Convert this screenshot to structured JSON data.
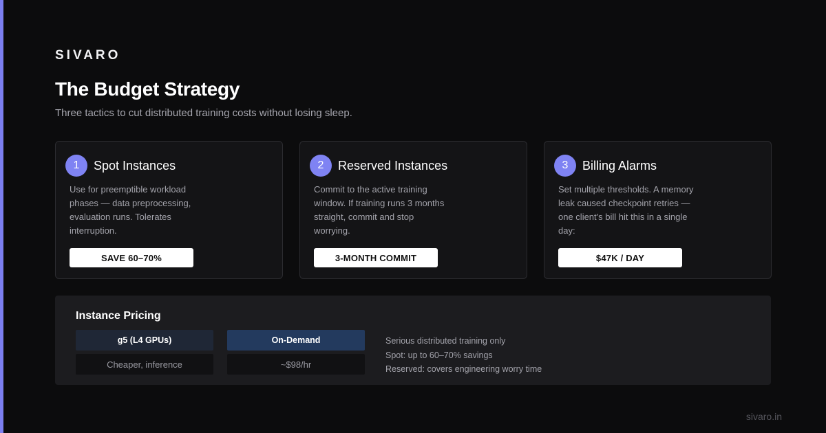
{
  "brand": "SIVARO",
  "title": "The Budget Strategy",
  "subtitle": "Three tactics to cut distributed training costs without losing sleep.",
  "colors": {
    "accent": "#7f83f3",
    "background": "#0c0c0d",
    "card_background": "#141416",
    "badge_background": "#ffffff"
  },
  "cards": [
    {
      "number": "1",
      "title": "Spot Instances",
      "description": "Use for preemptible workload phases — data preprocessing, evaluation runs. Tolerates interruption.",
      "badge": "SAVE 60–70%"
    },
    {
      "number": "2",
      "title": "Reserved Instances",
      "description": "Commit to the active training window. If training runs 3 months straight, commit and stop worrying.",
      "badge": "3-MONTH COMMIT"
    },
    {
      "number": "3",
      "title": "Billing Alarms",
      "description": "Set multiple thresholds. A memory leak caused checkpoint retries — one client's bill hit this in a single day:",
      "badge": "$47K / DAY"
    }
  ],
  "pricing": {
    "title": "Instance Pricing",
    "columns": [
      {
        "header": "g5 (L4 GPUs)",
        "value": "Cheaper, inference"
      },
      {
        "header": "On-Demand",
        "value": "~$98/hr"
      }
    ],
    "notes": [
      "Serious distributed training only",
      "Spot: up to 60–70% savings",
      "Reserved: covers engineering worry time"
    ]
  },
  "footer": "sivaro.in"
}
